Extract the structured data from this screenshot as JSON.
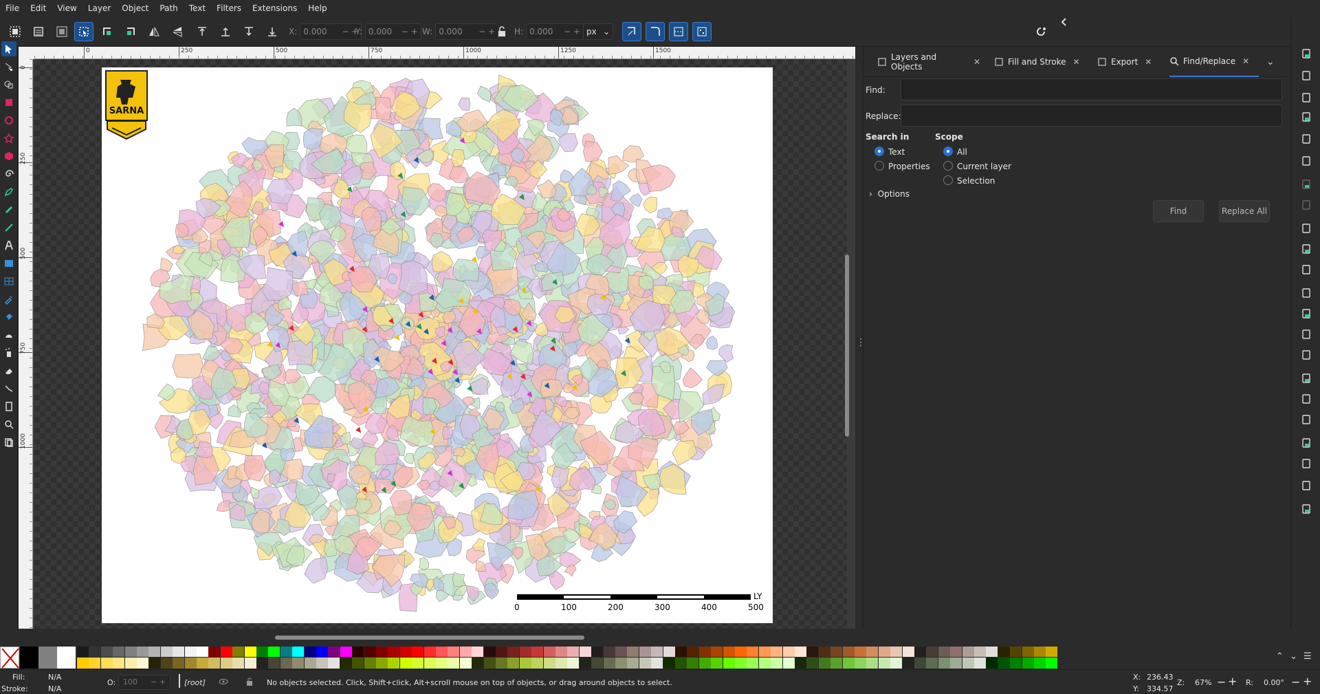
{
  "menubar": [
    "File",
    "Edit",
    "View",
    "Layer",
    "Object",
    "Path",
    "Text",
    "Filters",
    "Extensions",
    "Help"
  ],
  "toolbar": {
    "x_label": "X:",
    "x_value": "0.000",
    "y_label": "Y:",
    "y_value": "0.000",
    "w_label": "W:",
    "w_value": "0.000",
    "h_label": "H:",
    "h_value": "0.000",
    "unit": "px"
  },
  "rulers": {
    "h_ticks": [
      "0",
      "250",
      "500",
      "750",
      "1000",
      "1250",
      "1500"
    ],
    "v_ticks": [
      "0",
      "250",
      "500",
      "750",
      "1000"
    ]
  },
  "canvas": {
    "logo_text": "SARNA",
    "scale_unit": "LY",
    "scale_labels": [
      "0",
      "100",
      "200",
      "300",
      "400",
      "500"
    ]
  },
  "dock": {
    "tabs": [
      {
        "label": "Layers and Objects",
        "icon": "layers-icon"
      },
      {
        "label": "Fill and Stroke",
        "icon": "fill-stroke-icon"
      },
      {
        "label": "Export",
        "icon": "export-icon"
      },
      {
        "label": "Find/Replace",
        "icon": "search-icon",
        "active": true
      }
    ],
    "find_label": "Find:",
    "replace_label": "Replace:",
    "search_in_label": "Search in",
    "search_in_options": [
      "Text",
      "Properties"
    ],
    "search_in_selected": "Text",
    "scope_label": "Scope",
    "scope_options": [
      "All",
      "Current layer",
      "Selection"
    ],
    "scope_selected": "All",
    "options_label": "Options",
    "find_button": "Find",
    "replace_all_button": "Replace All"
  },
  "status": {
    "fill_label": "Fill:",
    "fill_value": "N/A",
    "stroke_label": "Stroke:",
    "stroke_value": "N/A",
    "opacity_label": "O:",
    "opacity_value": "100",
    "layer": "[root]",
    "message": "No objects selected. Click, Shift+click, Alt+scroll mouse on top of objects, or drag around objects to select.",
    "x_label": "X:",
    "x_value": "236.43",
    "y_label": "Y:",
    "y_value": "334.57",
    "zoom_label": "Z:",
    "zoom_value": "67%",
    "rotation_label": "R:",
    "rotation_value": "0.00°"
  },
  "colors": {
    "accent": "#1c4f8a",
    "accent_border": "#3d7ad0",
    "logo_yellow": "#f4c20d",
    "map_palette": [
      "#f7b7b7",
      "#b9c8e6",
      "#fbe08a",
      "#d6c3e6",
      "#b9dcc8",
      "#f5c9a8",
      "#e9b4d8",
      "#c8e6b9"
    ]
  }
}
